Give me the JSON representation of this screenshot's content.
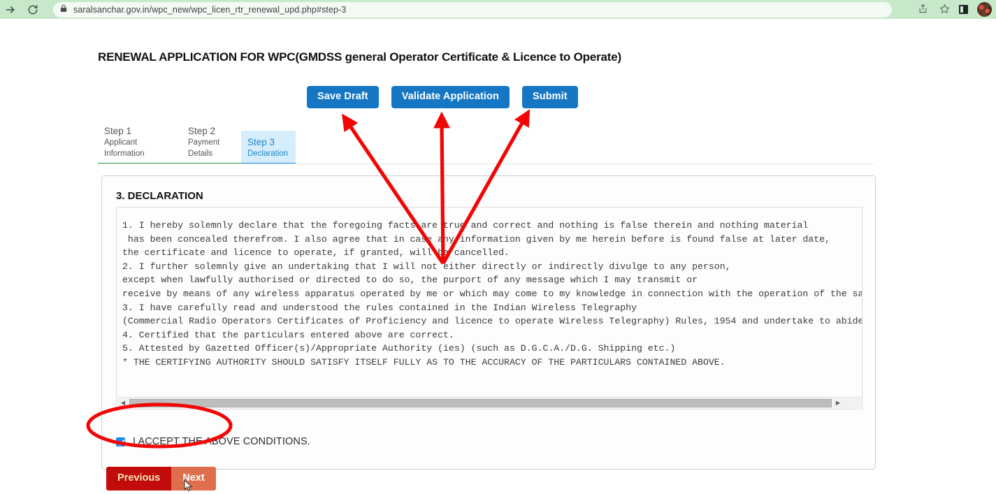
{
  "browser": {
    "url": "saralsanchar.gov.in/wpc_new/wpc_licen_rtr_renewal_upd.php#step-3",
    "forward_icon": "forward-arrow-icon",
    "reload_icon": "reload-icon",
    "lock_icon": "lock-icon",
    "share_icon": "share-icon",
    "bookmark_icon": "star-icon",
    "side_panel_icon": "side-panel-icon",
    "avatar_icon": "profile-avatar-icon"
  },
  "page": {
    "clipped_top_text": "",
    "title": "RENEWAL APPLICATION FOR WPC(GMDSS general Operator Certificate & Licence to Operate)"
  },
  "toolbar": {
    "save_draft_label": "Save Draft",
    "validate_label": "Validate Application",
    "submit_label": "Submit",
    "accent_color": "#1577c4"
  },
  "steps": [
    {
      "title": "Step 1",
      "subtitle": "Applicant Information",
      "state": "done"
    },
    {
      "title": "Step 2",
      "subtitle": "Payment Details",
      "state": "done"
    },
    {
      "title": "Step 3",
      "subtitle": "Declaration",
      "state": "active"
    }
  ],
  "declaration": {
    "heading": "3. DECLARATION",
    "body": "1. I hereby solemnly declare that the foregoing facts are true and correct and nothing is false therein and nothing material\n has been concealed therefrom. I also agree that in case any information given by me herein before is found false at later date,\nthe certificate and licence to operate, if granted, will be cancelled.\n2. I further solemnly give an undertaking that I will not either directly or indirectly divulge to any person,\nexcept when lawfully authorised or directed to do so, the purport of any message which I may transmit or\nreceive by means of any wireless apparatus operated by me or which may come to my knowledge in connection with the operation of the said apparatus.\n3. I have carefully read and understood the rules contained in the Indian Wireless Telegraphy\n(Commercial Radio Operators Certificates of Proficiency and licence to operate Wireless Telegraphy) Rules, 1954 and undertake to abide by them.\n4. Certified that the particulars entered above are correct.\n5. Attested by Gazetted Officer(s)/Appropriate Authority (ies) (such as D.G.C.A./D.G. Shipping etc.)\n* THE CERTIFYING AUTHORITY SHOULD SATISFY ITSELF FULLY AS TO THE ACCURACY OF THE PARTICULARS CONTAINED ABOVE.",
    "scrollbar_left_arrow": "◀",
    "scrollbar_right_arrow": "▶",
    "accept_label": "I ACCEPT THE ABOVE CONDITIONS.",
    "accept_checked": "true"
  },
  "navigation": {
    "previous_label": "Previous",
    "next_label": "Next",
    "previous_color": "#c20b0b",
    "next_color": "#df6f4c"
  },
  "annotations": {
    "color": "#f20505",
    "arrow_count": "3",
    "ellipse_target": "I ACCEPT THE ABOVE CONDITIONS."
  }
}
